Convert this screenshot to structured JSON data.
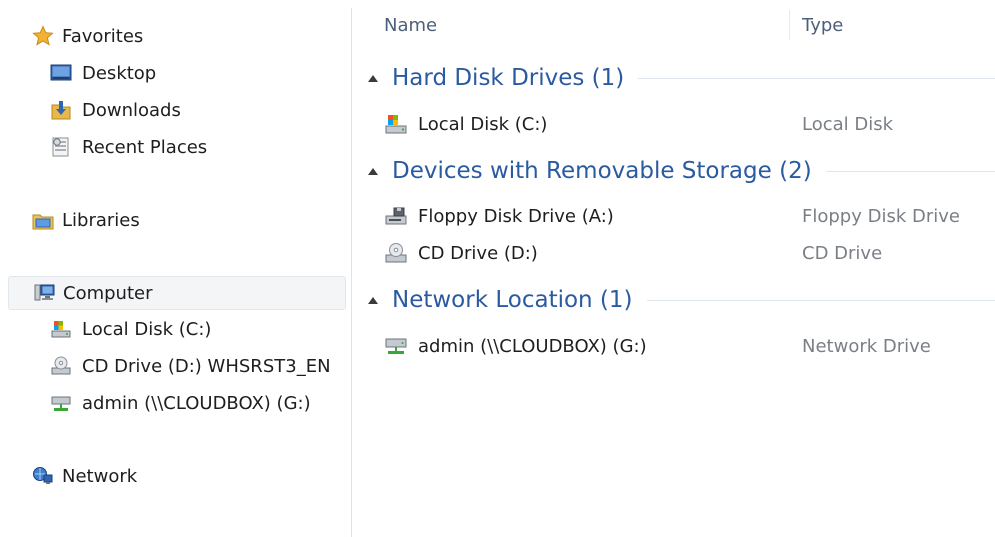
{
  "navigation": {
    "favorites": {
      "label": "Favorites",
      "icon": "star-icon",
      "items": [
        {
          "label": "Desktop",
          "icon": "desktop-icon"
        },
        {
          "label": "Downloads",
          "icon": "downloads-icon"
        },
        {
          "label": "Recent Places",
          "icon": "recent-places-icon"
        }
      ]
    },
    "libraries": {
      "label": "Libraries",
      "icon": "libraries-icon"
    },
    "computer": {
      "label": "Computer",
      "icon": "computer-icon",
      "selected": true,
      "items": [
        {
          "label": "Local Disk (C:)",
          "icon": "local-disk-icon"
        },
        {
          "label": "CD Drive (D:) WHSRST3_EN",
          "icon": "cd-drive-icon"
        },
        {
          "label": "admin (\\\\CLOUDBOX) (G:)",
          "icon": "network-drive-icon"
        }
      ]
    },
    "network": {
      "label": "Network",
      "icon": "network-icon"
    }
  },
  "columns": {
    "name": "Name",
    "type": "Type"
  },
  "groups": [
    {
      "title": "Hard Disk Drives (1)",
      "items": [
        {
          "name": "Local Disk (C:)",
          "type": "Local Disk",
          "icon": "local-disk-icon"
        }
      ]
    },
    {
      "title": "Devices with Removable Storage (2)",
      "items": [
        {
          "name": "Floppy Disk Drive (A:)",
          "type": "Floppy Disk Drive",
          "icon": "floppy-drive-icon"
        },
        {
          "name": "CD Drive (D:)",
          "type": "CD Drive",
          "icon": "cd-drive-icon"
        }
      ]
    },
    {
      "title": "Network Location (1)",
      "items": [
        {
          "name": "admin (\\\\CLOUDBOX) (G:)",
          "type": "Network Drive",
          "icon": "network-drive-icon"
        }
      ]
    }
  ],
  "colors": {
    "group_title": "#2a5aa0",
    "header_text": "#4c607a",
    "type_text": "#7a7f86"
  }
}
